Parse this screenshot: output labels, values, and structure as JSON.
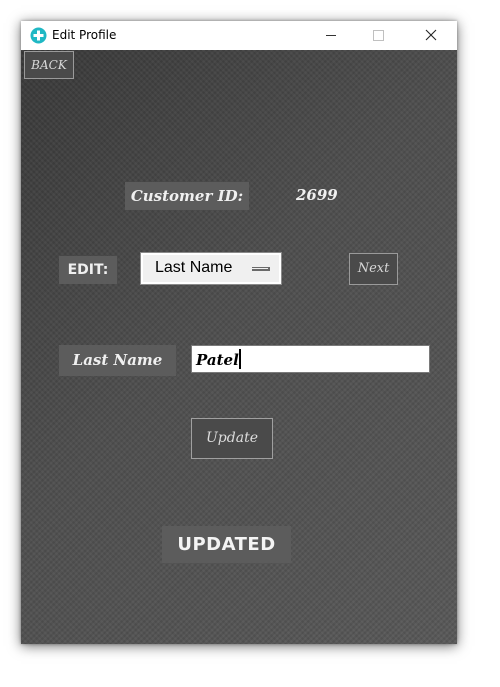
{
  "window": {
    "title": "Edit Profile"
  },
  "toolbar": {
    "back_label": "BACK"
  },
  "customer": {
    "id_label": "Customer ID:",
    "id_value": "2699"
  },
  "edit": {
    "label": "EDIT:",
    "field_selected": "Last Name",
    "next_label": "Next"
  },
  "field": {
    "label": "Last Name",
    "value": "Patel"
  },
  "actions": {
    "update_label": "Update"
  },
  "status": {
    "text": "UPDATED"
  },
  "icons": {
    "app": "plus-circle-icon",
    "minimize": "minimize-icon",
    "maximize": "maximize-icon",
    "close": "close-icon"
  },
  "colors": {
    "app_icon": "#1fb8c4",
    "background": "#4b4b4b",
    "label_box": "#5c5c5c"
  }
}
